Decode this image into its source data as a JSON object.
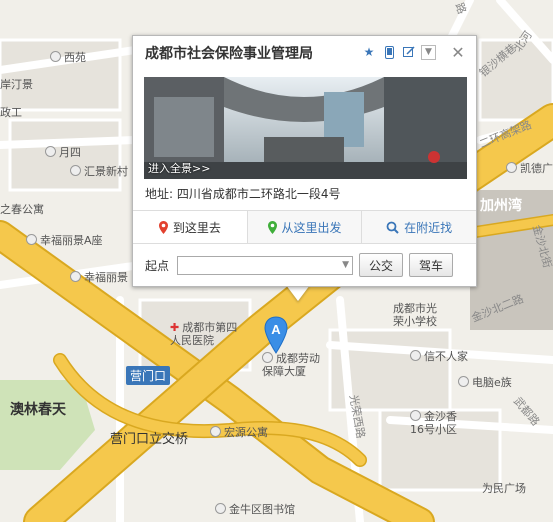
{
  "popup": {
    "title": "成都市社会保险事业管理局",
    "pano_label": "进入全景>>",
    "address_label": "地址:",
    "address_value": "四川省成都市二环路北一段4号",
    "tabs": [
      {
        "label": "到这里去",
        "icon": "pin-red-icon"
      },
      {
        "label": "从这里出发",
        "icon": "pin-green-icon"
      },
      {
        "label": "在附近找",
        "icon": "search-icon"
      }
    ],
    "start_label": "起点",
    "start_value": "",
    "bus_button": "公交",
    "drive_button": "驾车",
    "tools": [
      "star-icon",
      "phone-icon",
      "edit-icon",
      "dropdown-icon",
      "close-icon"
    ]
  },
  "marker": {
    "letter": "A",
    "color": "#3a8ee6"
  },
  "map": {
    "labels": {
      "xiyuan": "西苑",
      "anjing": "岸汀景",
      "zhengong": "政工",
      "yuesi": "月四",
      "huijing": "汇景新村",
      "zhijia": "之春公寓",
      "xingfu_a": "幸福丽景A座",
      "xingfu_b": "幸福丽景",
      "hospital": "成都市第四人民医院",
      "yingmenkou": "营门口",
      "aolin": "澳林春天",
      "interchange": "营门口立交桥",
      "hongyuan": "宏源公寓",
      "jinniu_lib": "金牛区图书馆",
      "laodong": "成都劳动保障大厦",
      "guangrong": "成都市光荣小学校",
      "xinbu": "信不人家",
      "jinshabei": "金沙北二路",
      "guangrongxi": "光荣西路",
      "jinsha16": "金沙香16号小区",
      "diannao": "电脑e族",
      "weimin": "为民广场",
      "ring_road": "二环高架路",
      "kaide": "凯德广",
      "jiazhouwan": "加州湾",
      "yinshaheng": "银沙横巷",
      "beihe": "北河",
      "wuzhen": "武都路",
      "lu": "路",
      "jinshabei_jie": "金沙北街"
    },
    "colors": {
      "major_road": "#f5c84c",
      "road_edge": "#d9a820",
      "water": "#aad3df",
      "green": "#cfe3b8",
      "land": "#f1efe9"
    }
  }
}
